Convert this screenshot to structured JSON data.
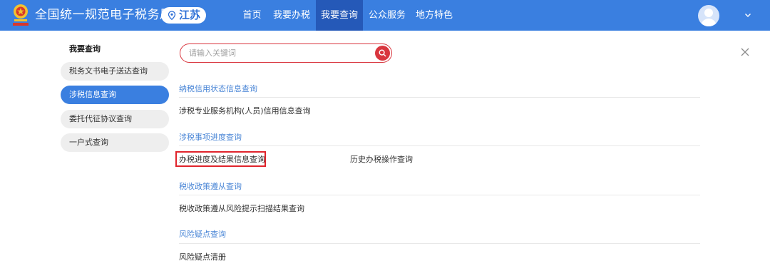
{
  "header": {
    "site_title": "全国统一规范电子税务局",
    "region": "江苏",
    "nav": [
      {
        "label": "首页",
        "active": false
      },
      {
        "label": "我要办税",
        "active": false
      },
      {
        "label": "我要查询",
        "active": true
      },
      {
        "label": "公众服务",
        "active": false
      },
      {
        "label": "地方特色",
        "active": false
      }
    ]
  },
  "sidebar": {
    "title": "我要查询",
    "items": [
      {
        "label": "税务文书电子送达查询",
        "active": false
      },
      {
        "label": "涉税信息查询",
        "active": true
      },
      {
        "label": "委托代征协议查询",
        "active": false
      },
      {
        "label": "一户式查询",
        "active": false
      }
    ]
  },
  "search": {
    "placeholder": "请输入关键词"
  },
  "sections": [
    {
      "title": "纳税信用状态信息查询",
      "links": [
        "涉税专业服务机构(人员)信用信息查询"
      ]
    },
    {
      "title": "涉税事项进度查询",
      "links": [
        "办税进度及结果信息查询",
        "历史办税操作查询"
      ]
    },
    {
      "title": "税收政策遵从查询",
      "links": [
        "税收政策遵从风险提示扫描结果查询"
      ]
    },
    {
      "title": "风险疑点查询",
      "links": [
        "风险疑点清册"
      ]
    }
  ],
  "colors": {
    "header_blue": "#3a7fe0",
    "nav_active": "#2559b8",
    "section_blue": "#4a86d6",
    "search_red": "#d9363e",
    "highlight_red": "#e0242c"
  },
  "icons": {
    "emblem": "tax-emblem-icon",
    "region": "location-pin-icon",
    "search": "search-icon",
    "close": "close-icon",
    "avatar": "user-avatar-icon",
    "caret": "chevron-down-icon"
  }
}
